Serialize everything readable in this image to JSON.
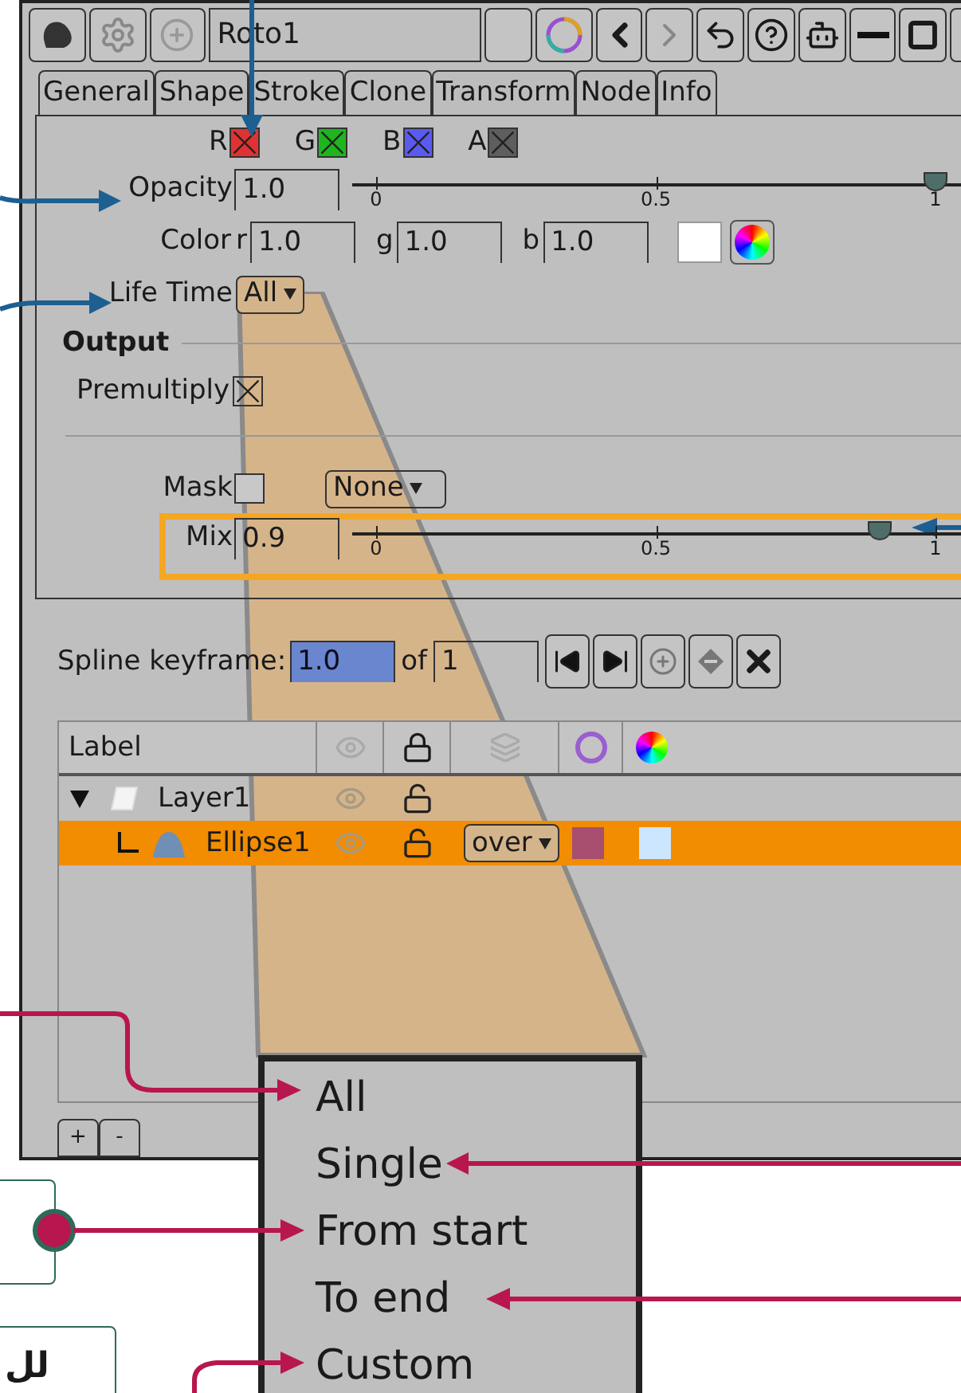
{
  "title_bar": {
    "title": "Roto1"
  },
  "tabs": [
    {
      "label": "General"
    },
    {
      "label": "Shape"
    },
    {
      "label": "Stroke"
    },
    {
      "label": "Clone"
    },
    {
      "label": "Transform"
    },
    {
      "label": "Node"
    },
    {
      "label": "Info"
    }
  ],
  "channels": [
    {
      "label": "R",
      "checked": true,
      "color": "#e03232"
    },
    {
      "label": "G",
      "checked": true,
      "color": "#1fb51f"
    },
    {
      "label": "B",
      "checked": true,
      "color": "#5a5af0"
    },
    {
      "label": "A",
      "checked": true,
      "color": "#5e5e5e"
    }
  ],
  "opacity": {
    "label": "Opacity",
    "value": "1.0",
    "level": 1,
    "ticks": [
      "0",
      "0.5",
      "1"
    ]
  },
  "color": {
    "label": "Color",
    "fields": [
      {
        "label": "r",
        "value": "1.0"
      },
      {
        "label": "g",
        "value": "1.0"
      },
      {
        "label": "b",
        "value": "1.0"
      }
    ]
  },
  "life_time": {
    "label": "Life Time",
    "value": "All"
  },
  "output": {
    "heading": "Output",
    "premultiply": {
      "label": "Premultiply",
      "checked": true
    },
    "mask": {
      "label": "Mask",
      "checked": false,
      "value": "None"
    },
    "mix": {
      "label": "Mix",
      "value": "0.9",
      "level": 0.9,
      "ticks": [
        "0",
        "0.5",
        "1"
      ]
    }
  },
  "spline_keyframe": {
    "label": "Spline keyframe:",
    "value": "1.0",
    "of_label": "of",
    "total": "1"
  },
  "layers": {
    "columns": [
      "Label"
    ],
    "rows": [
      {
        "label": "Layer1",
        "expanded": true,
        "selected": false,
        "children": [
          {
            "label": "Ellipse1",
            "selected": true,
            "blend": "over",
            "swatches": [
              {
                "color": "#a84e6e"
              },
              {
                "color": "#cce6ff"
              }
            ]
          }
        ]
      }
    ]
  },
  "list_buttons": [
    "+",
    "-"
  ],
  "lifetime_menu": [
    "All",
    "Single",
    "From start",
    "To end",
    "Custom"
  ],
  "callout_text": "لل"
}
